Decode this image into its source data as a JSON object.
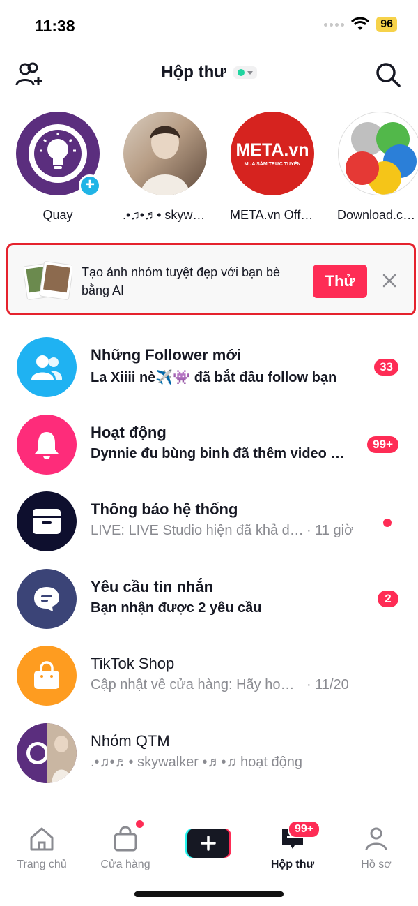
{
  "status_bar": {
    "time": "11:38",
    "battery": "96"
  },
  "header": {
    "title": "Hộp thư"
  },
  "stories": [
    {
      "label": "Quay"
    },
    {
      "label": ".•♫•♬• skywalker"
    },
    {
      "label": "META.vn Official"
    },
    {
      "label": "Download.com.vn"
    }
  ],
  "meta_logo": {
    "main": "META.vn",
    "sub": "MUA SẮM TRỰC TUYẾN"
  },
  "banner": {
    "text": "Tạo ảnh nhóm tuyệt đẹp với bạn bè bằng AI",
    "try_label": "Thử"
  },
  "inbox": [
    {
      "name": "Những Follower mới",
      "subtitle": "La Xiiii nè✈️👾 đã bắt đầu follow bạn",
      "badge": "33",
      "icon": "people-icon",
      "color": "#1fb2f2"
    },
    {
      "name": "Hoạt động",
      "subtitle": "Dynnie đu bùng binh đã thêm video mới",
      "badge": "99+",
      "icon": "bell-icon",
      "color": "#fe2c7a"
    },
    {
      "name": "Thông báo hệ thống",
      "subtitle": "LIVE: LIVE Studio hiện đã khả dụng",
      "time": "· 11 giờ",
      "icon": "inbox-tray-icon",
      "color": "#0e0f2e"
    },
    {
      "name": "Yêu cầu tin nhắn",
      "subtitle": "Bạn nhận được 2 yêu cầu",
      "badge": "2",
      "icon": "chat-bubble-icon",
      "color": "#3b4477"
    },
    {
      "name": "TikTok Shop",
      "subtitle": "Cập nhật về cửa hàng: Hãy hoàn tất",
      "time": "· 11/20",
      "icon": "shopping-bag-icon",
      "color": "#fe9c20"
    },
    {
      "name": "Nhóm QTM",
      "subtitle": ".•♫•♬• skywalker •♬•♫ hoạt động",
      "icon": "group-avatar-icon",
      "color": "#5b2e7e"
    }
  ],
  "bottom_nav": {
    "home": "Trang chủ",
    "shop": "Cửa hàng",
    "inbox": "Hộp thư",
    "inbox_badge": "99+",
    "profile": "Hồ sơ"
  },
  "colors": {
    "accent": "#fe2c55",
    "banner_border": "#e5222d"
  }
}
